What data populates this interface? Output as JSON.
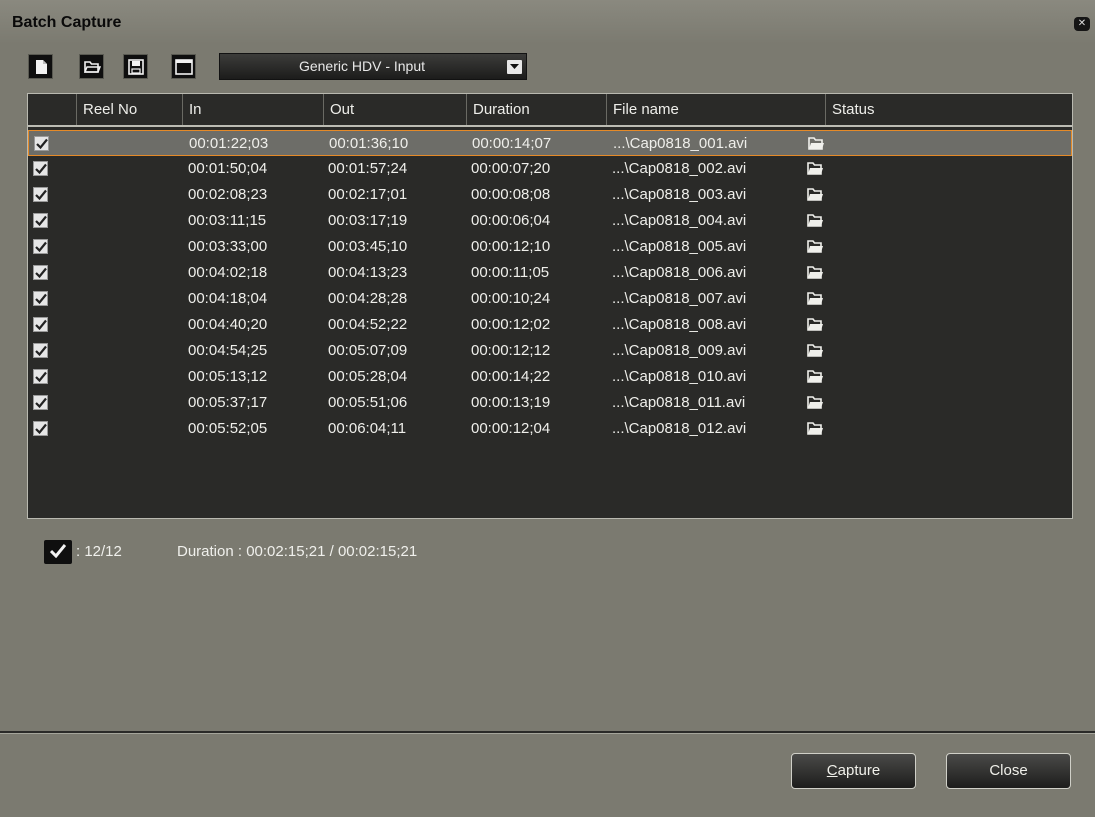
{
  "window": {
    "title": "Batch Capture"
  },
  "toolbar": {
    "icons": [
      "new-list-icon",
      "open-folder-icon",
      "save-icon",
      "window-icon"
    ],
    "preset": "Generic HDV - Input"
  },
  "table": {
    "columns": [
      "",
      "Reel No",
      "In",
      "Out",
      "Duration",
      "File name",
      "Status"
    ],
    "rows": [
      {
        "checked": true,
        "reel": "",
        "in": "00:01:22;03",
        "out": "00:01:36;10",
        "duration": "00:00:14;07",
        "file": "...\\Cap0818_001.avi",
        "status": ""
      },
      {
        "checked": true,
        "reel": "",
        "in": "00:01:50;04",
        "out": "00:01:57;24",
        "duration": "00:00:07;20",
        "file": "...\\Cap0818_002.avi",
        "status": ""
      },
      {
        "checked": true,
        "reel": "",
        "in": "00:02:08;23",
        "out": "00:02:17;01",
        "duration": "00:00:08;08",
        "file": "...\\Cap0818_003.avi",
        "status": ""
      },
      {
        "checked": true,
        "reel": "",
        "in": "00:03:11;15",
        "out": "00:03:17;19",
        "duration": "00:00:06;04",
        "file": "...\\Cap0818_004.avi",
        "status": ""
      },
      {
        "checked": true,
        "reel": "",
        "in": "00:03:33;00",
        "out": "00:03:45;10",
        "duration": "00:00:12;10",
        "file": "...\\Cap0818_005.avi",
        "status": ""
      },
      {
        "checked": true,
        "reel": "",
        "in": "00:04:02;18",
        "out": "00:04:13;23",
        "duration": "00:00:11;05",
        "file": "...\\Cap0818_006.avi",
        "status": ""
      },
      {
        "checked": true,
        "reel": "",
        "in": "00:04:18;04",
        "out": "00:04:28;28",
        "duration": "00:00:10;24",
        "file": "...\\Cap0818_007.avi",
        "status": ""
      },
      {
        "checked": true,
        "reel": "",
        "in": "00:04:40;20",
        "out": "00:04:52;22",
        "duration": "00:00:12;02",
        "file": "...\\Cap0818_008.avi",
        "status": ""
      },
      {
        "checked": true,
        "reel": "",
        "in": "00:04:54;25",
        "out": "00:05:07;09",
        "duration": "00:00:12;12",
        "file": "...\\Cap0818_009.avi",
        "status": ""
      },
      {
        "checked": true,
        "reel": "",
        "in": "00:05:13;12",
        "out": "00:05:28;04",
        "duration": "00:00:14;22",
        "file": "...\\Cap0818_010.avi",
        "status": ""
      },
      {
        "checked": true,
        "reel": "",
        "in": "00:05:37;17",
        "out": "00:05:51;06",
        "duration": "00:00:13;19",
        "file": "...\\Cap0818_011.avi",
        "status": ""
      },
      {
        "checked": true,
        "reel": "",
        "in": "00:05:52;05",
        "out": "00:06:04;11",
        "duration": "00:00:12;04",
        "file": "...\\Cap0818_012.avi",
        "status": ""
      }
    ],
    "selected_row": 0
  },
  "summary": {
    "count": ": 12/12",
    "duration": "Duration :  00:02:15;21 / 00:02:15;21"
  },
  "buttons": {
    "capture_mnemonic": "C",
    "capture_rest": "apture",
    "close": "Close"
  },
  "colors": {
    "panel": "#7b7a70",
    "grid": "#2a2a28",
    "selection_border": "#e58a28"
  }
}
